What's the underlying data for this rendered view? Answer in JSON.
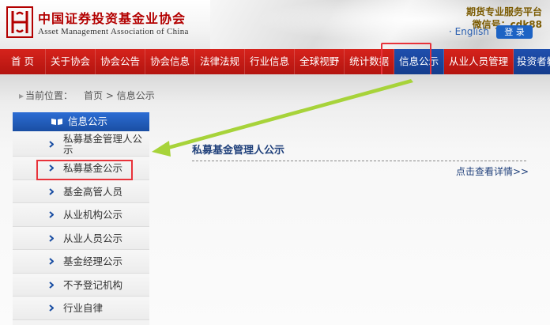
{
  "header": {
    "org_name_cn": "中国证券投资基金业协会",
    "org_name_en": "Asset Management Association of China",
    "promo_line1": "期货专业服务平台",
    "promo_line2": "微信号：cdk88",
    "lang_link": "English",
    "login_label": "登 录"
  },
  "nav": {
    "items": [
      {
        "label": "首 页"
      },
      {
        "label": "关于协会"
      },
      {
        "label": "协会公告"
      },
      {
        "label": "协会信息"
      },
      {
        "label": "法律法规"
      },
      {
        "label": "行业信息"
      },
      {
        "label": "全球视野"
      },
      {
        "label": "统计数据"
      },
      {
        "label": "信息公示"
      },
      {
        "label": "从业人员管理"
      },
      {
        "label": "投资者教育"
      }
    ],
    "active_index": 8
  },
  "breadcrumb": {
    "prefix": "当前位置：",
    "path": "首页 > 信息公示"
  },
  "sidebar": {
    "title": "信息公示",
    "items": [
      {
        "label": "私募基金管理人公示"
      },
      {
        "label": "私募基金公示"
      },
      {
        "label": "基金高管人员"
      },
      {
        "label": "从业机构公示"
      },
      {
        "label": "从业人员公示"
      },
      {
        "label": "基金经理公示"
      },
      {
        "label": "不予登记机构"
      },
      {
        "label": "行业自律"
      }
    ]
  },
  "content": {
    "title": "私募基金管理人公示",
    "more_link": "点击查看详情>>"
  },
  "colors": {
    "nav_red": "#c81c16",
    "nav_active_blue": "#1a4ea3",
    "highlight_red": "#e8323a",
    "arrow_green": "#9fcf2c"
  }
}
